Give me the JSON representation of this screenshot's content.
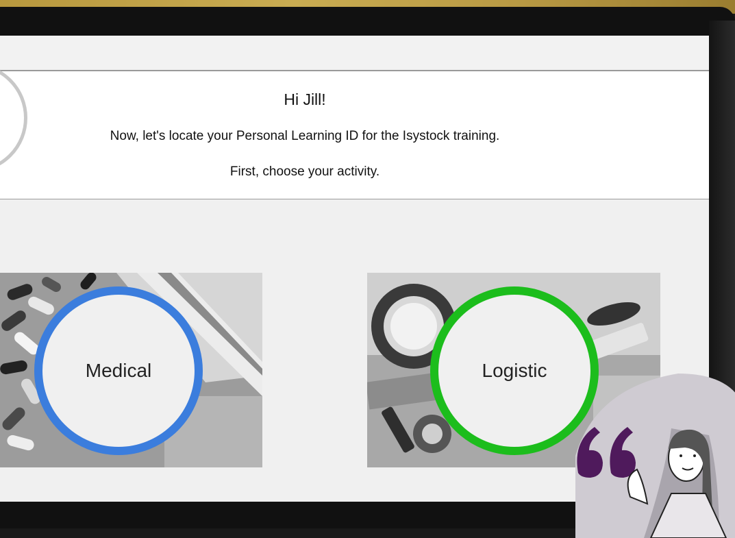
{
  "banner": {
    "title": "Hi Jill!",
    "line1": "Now, let's locate your Personal Learning ID for the Isystock training.",
    "line2": "First, choose your activity."
  },
  "choices": [
    {
      "label": "Medical",
      "ring_color": "#3b7ddd",
      "icon": "pills-photo"
    },
    {
      "label": "Logistic",
      "ring_color": "#1cbd1c",
      "icon": "tape-and-scissors-photo"
    }
  ],
  "overlay": {
    "icon": "quote-mark-icon",
    "quote_color": "#4f1a5c",
    "figure": "woman-illustration"
  }
}
